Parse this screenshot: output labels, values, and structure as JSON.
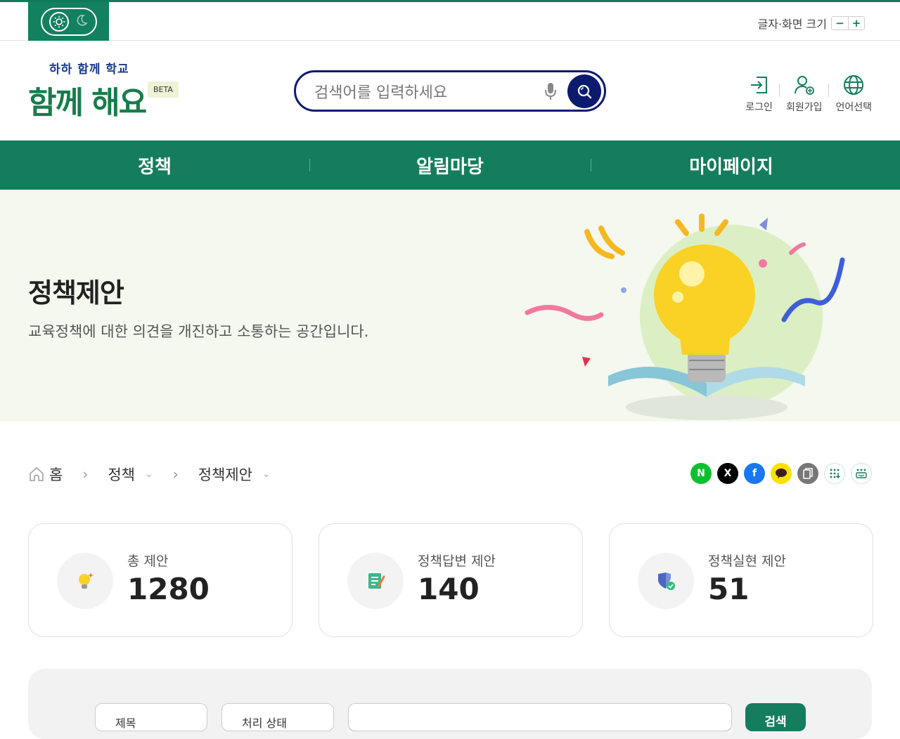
{
  "util": {
    "font_size_label": "글자·화면 크기",
    "decrease": "−",
    "increase": "+"
  },
  "header": {
    "logo_sub": "하하 함께 학교",
    "logo_main": "함께 해요",
    "beta": "BETA",
    "search_placeholder": "검색어를 입력하세요",
    "login": "로그인",
    "signup": "회원가입",
    "language": "언어선택"
  },
  "gnb": [
    "정책",
    "알림마당",
    "마이페이지"
  ],
  "hero": {
    "title": "정책제안",
    "desc": "교육정책에 대한 의견을 개진하고 소통하는 공간입니다."
  },
  "breadcrumb": {
    "home": "홈",
    "level1": "정책",
    "level2": "정책제안"
  },
  "share_icons": [
    "naver-icon",
    "x-icon",
    "facebook-icon",
    "kakaotalk-icon",
    "copy-icon",
    "qr-icon",
    "print-icon"
  ],
  "stats": [
    {
      "label": "총 제안",
      "value": "1280",
      "icon": "lightbulb-icon"
    },
    {
      "label": "정책답변 제안",
      "value": "140",
      "icon": "memo-icon"
    },
    {
      "label": "정책실현 제안",
      "value": "51",
      "icon": "shield-check-icon"
    }
  ],
  "filter": {
    "sel1": "제목",
    "sel2": "처리 상태",
    "button": "검색"
  },
  "colors": {
    "primary": "#147d5d",
    "navy": "#0d1b6e",
    "hero_bg": "#f4f8ee"
  }
}
